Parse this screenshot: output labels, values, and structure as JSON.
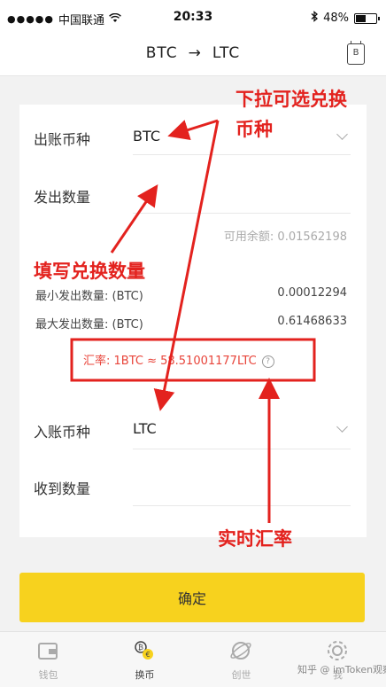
{
  "status_bar": {
    "carrier": "中国联通",
    "time": "20:33",
    "battery": "48%",
    "battery_level": 0.48
  },
  "nav": {
    "from": "BTC",
    "arrow": "→",
    "to": "LTC",
    "icon_label": "B"
  },
  "send": {
    "currency_label": "出账币种",
    "currency_value": "BTC",
    "amount_label": "发出数量",
    "available": "可用余额: 0.01562198",
    "min_label": "最小发出数量: (BTC)",
    "min_value": "0.00012294",
    "max_label": "最大发出数量: (BTC)",
    "max_value": "0.61468633",
    "rate": "汇率: 1BTC ≈ 58.51001177LTC",
    "rate_help": "?"
  },
  "receive": {
    "currency_label": "入账币种",
    "currency_value": "LTC",
    "amount_label": "收到数量"
  },
  "confirm_label": "确定",
  "tabs": [
    {
      "label": "钱包",
      "icon": "wallet-icon",
      "active": false
    },
    {
      "label": "换币",
      "icon": "exchange-icon",
      "active": true
    },
    {
      "label": "创世",
      "icon": "planet-icon",
      "active": false
    },
    {
      "label": "我",
      "icon": "gear-icon",
      "active": false
    }
  ],
  "annotations": {
    "dropdown_hint_line1": "下拉可选兑换",
    "dropdown_hint_line2": "币种",
    "fill_amount_hint": "填写兑换数量",
    "realtime_rate_hint": "实时汇率"
  },
  "watermark": "知乎 @ imToken观察",
  "colors": {
    "accent_yellow": "#f7d21e",
    "annotation_red": "#e3221e",
    "rate_red": "#e8443a"
  }
}
